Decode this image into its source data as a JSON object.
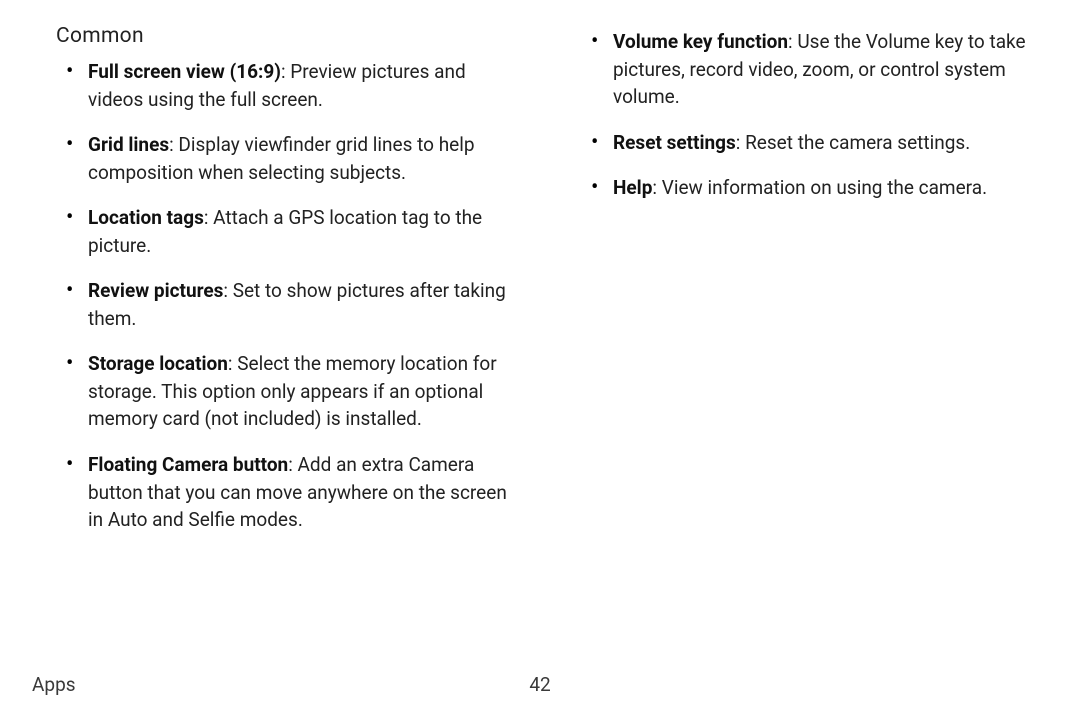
{
  "section_title": "Common",
  "left_items": [
    {
      "term": "Full screen view (16:9)",
      "desc": ": Preview pictures and videos using the full screen."
    },
    {
      "term": "Grid lines",
      "desc": ": Display viewfinder grid lines to help composition when selecting subjects."
    },
    {
      "term": "Location tags",
      "desc": ": Attach a GPS location tag to the picture."
    },
    {
      "term": "Review pictures",
      "desc": ": Set to show pictures after taking them."
    },
    {
      "term": "Storage location",
      "desc": ": Select the memory location for storage. This option only appears if an optional memory card (not included) is installed."
    },
    {
      "term": "Floating Camera button",
      "desc": ": Add an extra Camera button that you can move anywhere on the screen in Auto and Selfie modes."
    }
  ],
  "right_items": [
    {
      "term": "Volume key function",
      "desc": ": Use the Volume key to take pictures, record video, zoom, or control system volume."
    },
    {
      "term": "Reset settings",
      "desc": ": Reset the camera settings."
    },
    {
      "term": "Help",
      "desc": ": View information on using the camera."
    }
  ],
  "footer": {
    "section": "Apps",
    "page": "42"
  }
}
